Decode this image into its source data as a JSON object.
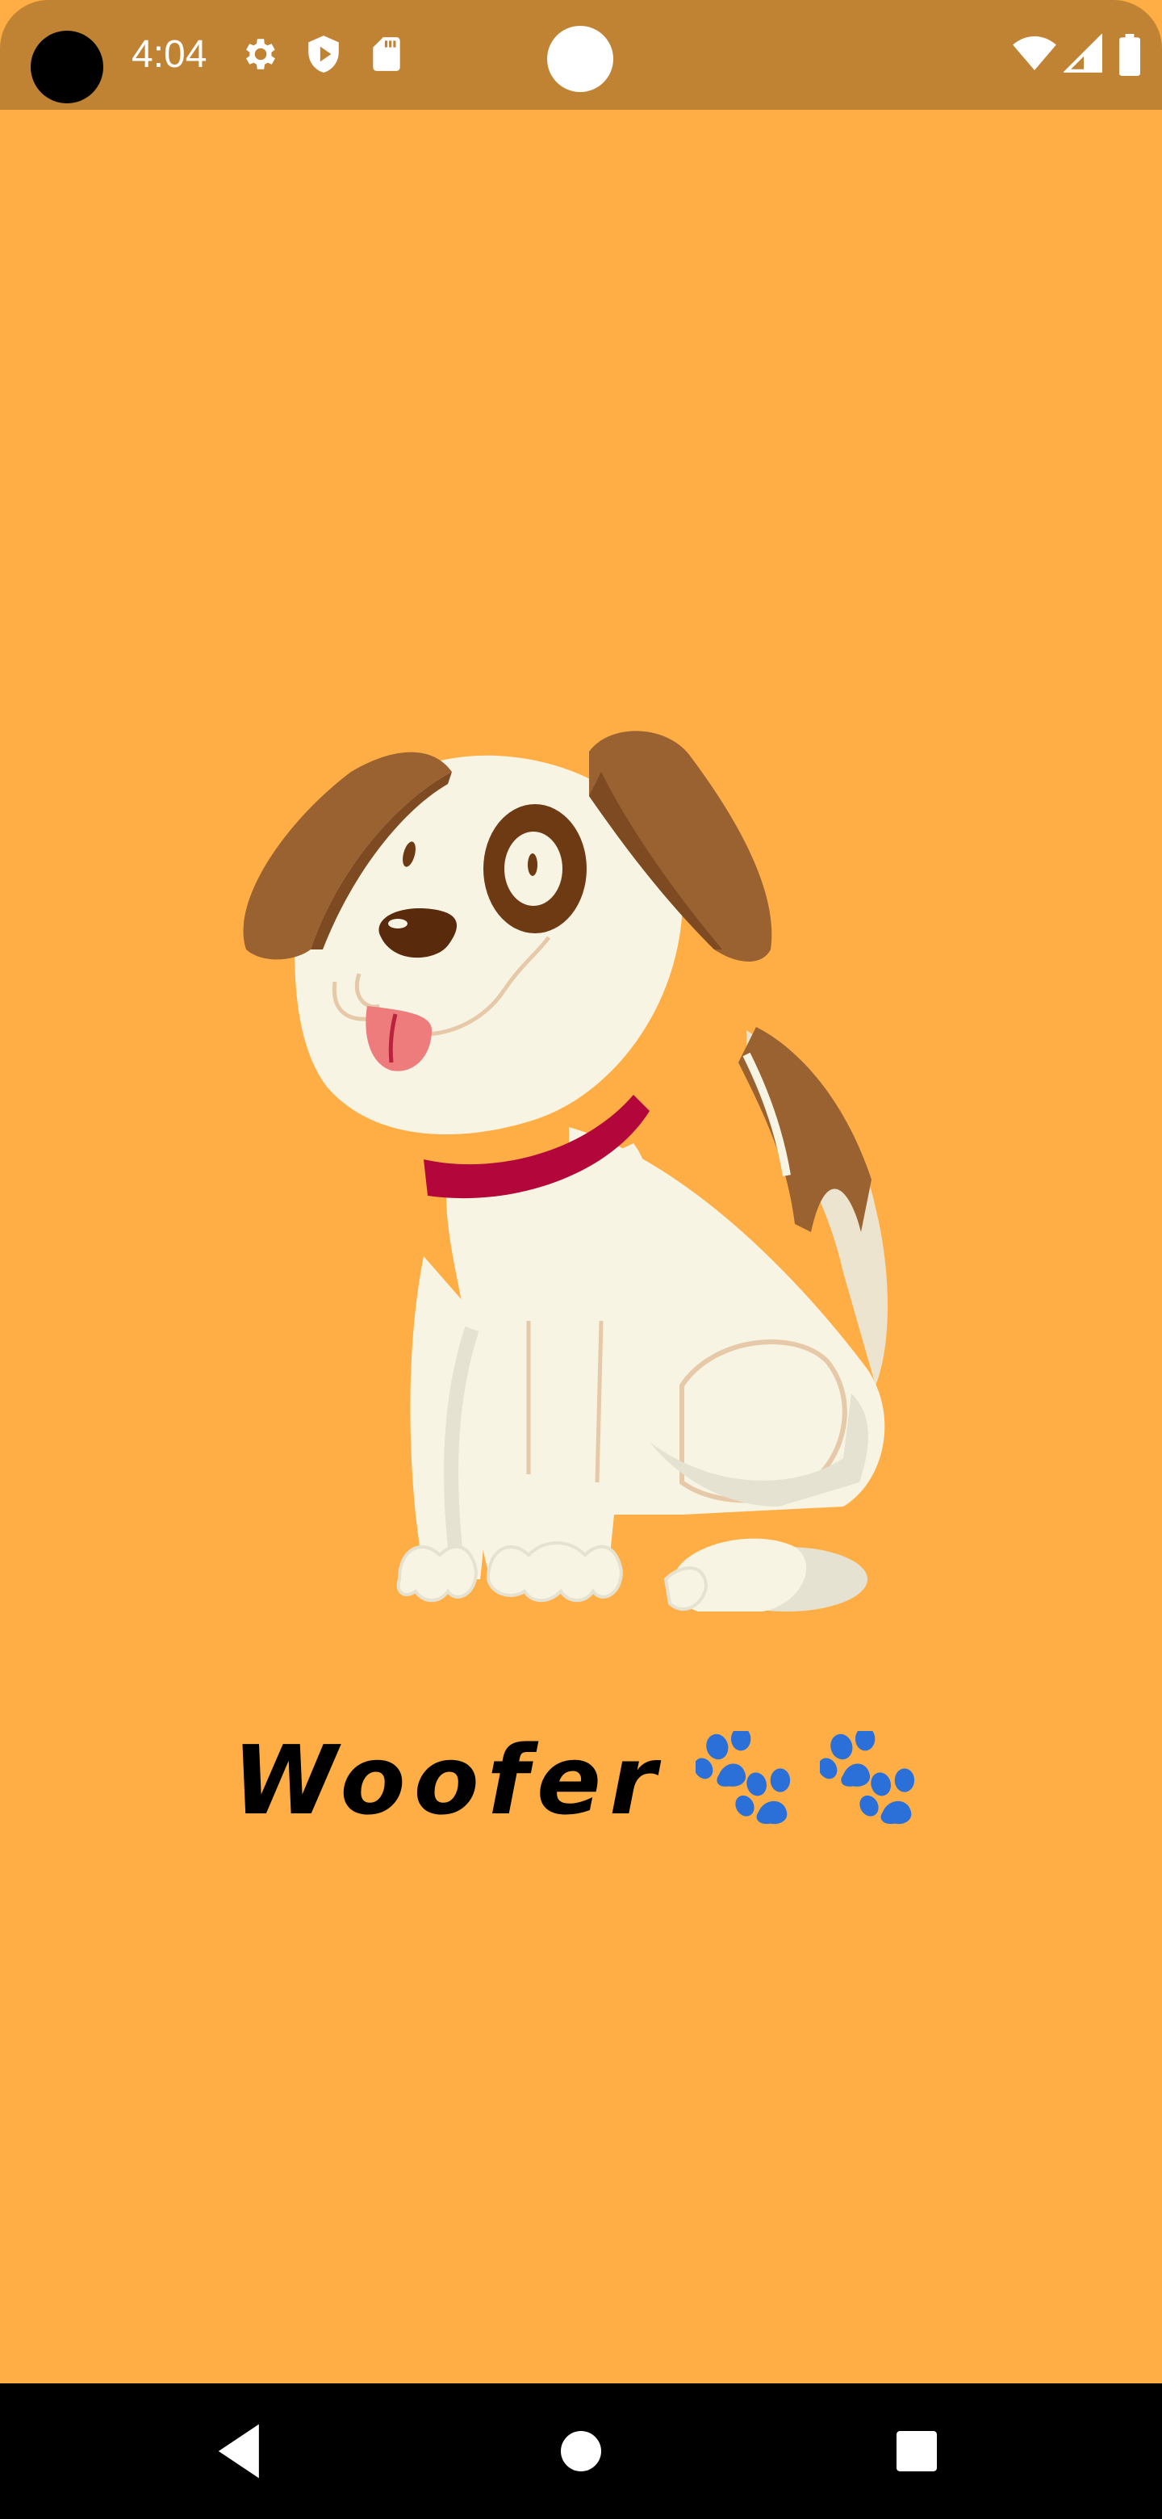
{
  "status_bar": {
    "time": "4:04",
    "icons": [
      "settings-icon",
      "shield-play-icon",
      "sd-card-icon",
      "wifi-icon",
      "cell-signal-icon",
      "battery-icon"
    ]
  },
  "splash": {
    "title": "Woofer",
    "illustration": "cartoon-dog",
    "paw_icons": [
      "paw-print-icon",
      "paw-print-icon"
    ]
  },
  "navigation": {
    "buttons": [
      "back-icon",
      "home-icon",
      "recents-icon"
    ]
  },
  "colors": {
    "background": "#FFAE45",
    "status_bar": "#C08333",
    "paw": "#2A70D8",
    "dog_ear": "#9A6231",
    "dog_body": "#F8F4E3",
    "collar": "#B3063B",
    "nav_bar": "#000000"
  }
}
